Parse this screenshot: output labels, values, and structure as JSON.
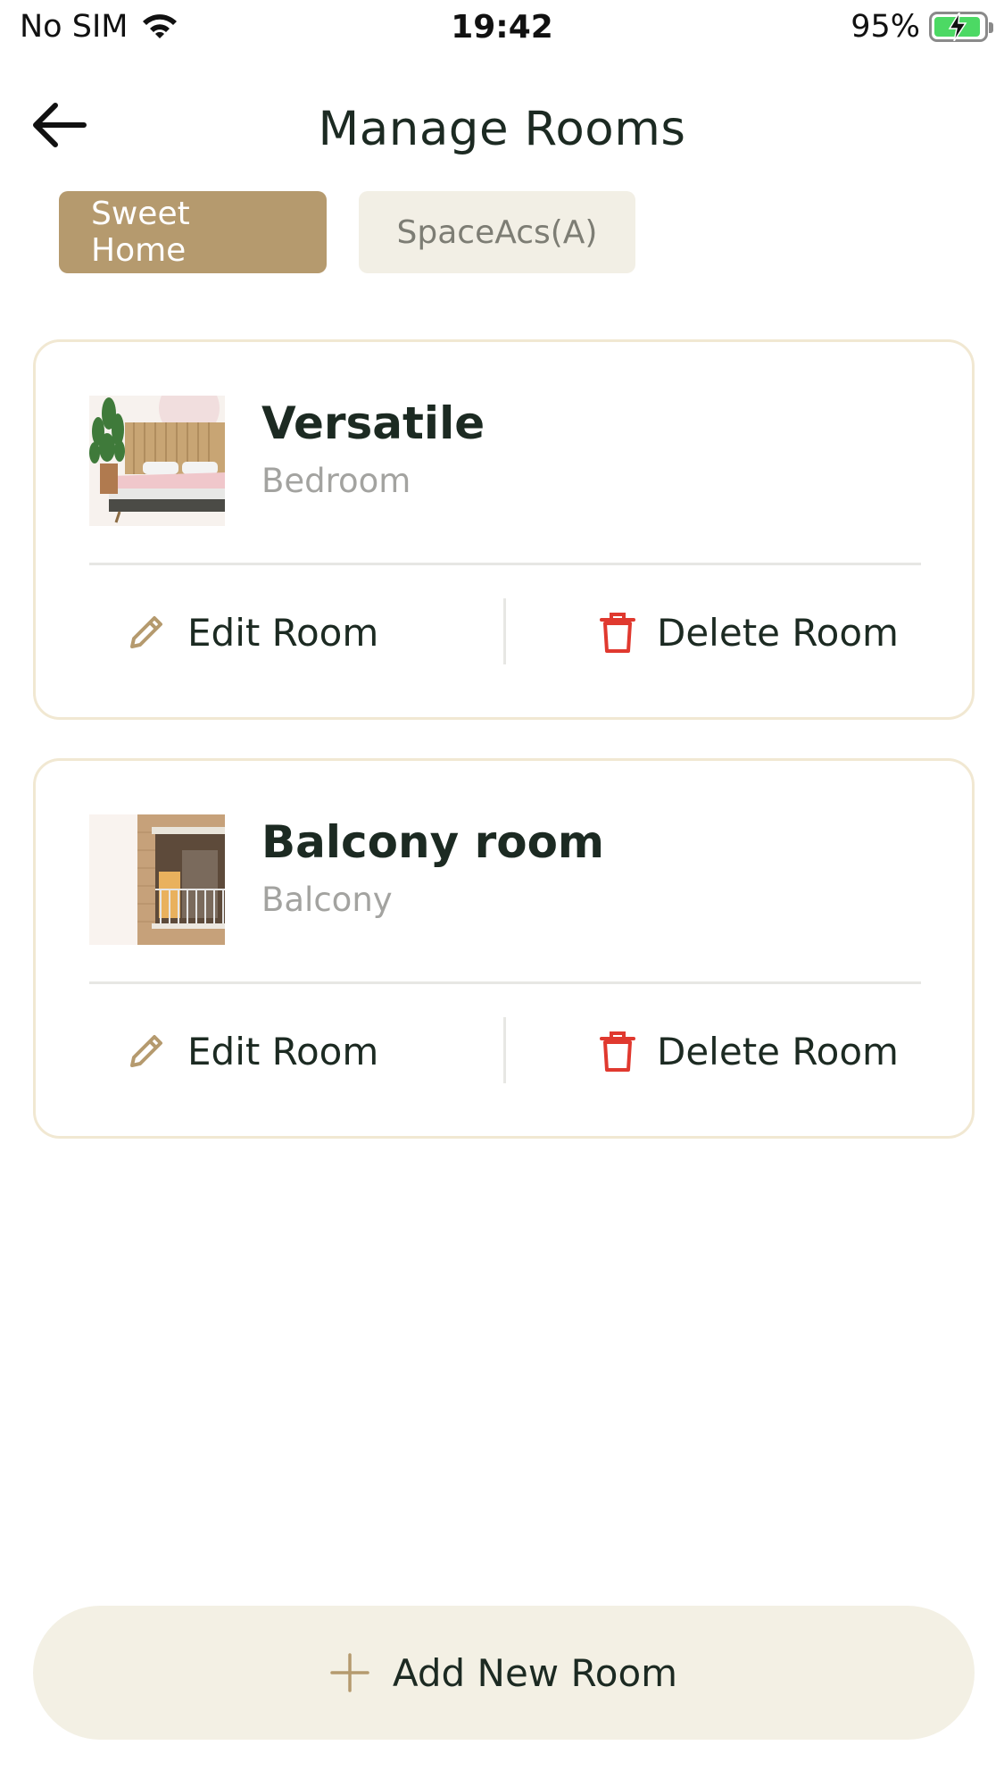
{
  "status_bar": {
    "carrier": "No SIM",
    "time": "19:42",
    "battery_percent": "95%",
    "battery_level": 0.95,
    "icons": [
      "wifi-icon",
      "battery-charging-icon"
    ]
  },
  "header": {
    "title": "Manage Rooms",
    "back_icon": "arrow-left-icon"
  },
  "tabs": [
    {
      "label": "Sweet Home",
      "active": true
    },
    {
      "label": "SpaceAcs(A)",
      "active": false
    }
  ],
  "rooms": [
    {
      "name": "Versatile",
      "type": "Bedroom",
      "edit_label": "Edit Room",
      "delete_label": "Delete Room"
    },
    {
      "name": "Balcony room",
      "type": "Balcony",
      "edit_label": "Edit Room",
      "delete_label": "Delete Room"
    }
  ],
  "add_button": {
    "label": "Add New Room",
    "icon": "plus-icon"
  },
  "colors": {
    "accent": "#b59a6e",
    "delete": "#e0392f",
    "card_border": "#f1e8d2",
    "add_button_bg": "#f3f0e4"
  }
}
